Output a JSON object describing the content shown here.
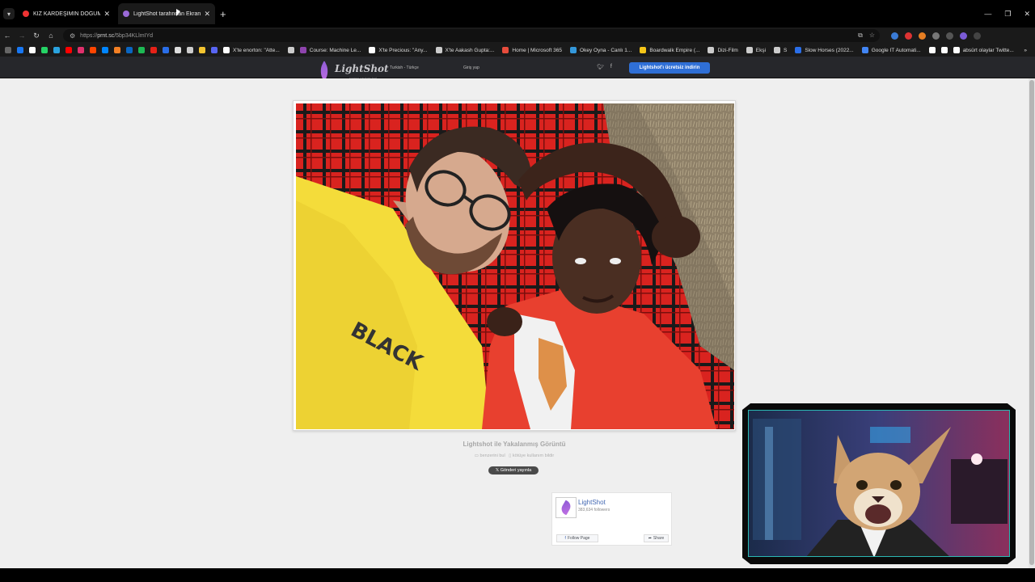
{
  "browser": {
    "tabs": [
      {
        "label": "KIZ KARDEŞİMİN DOĞUM GÜNÜ",
        "active": false,
        "favicon_color": "#e33"
      },
      {
        "label": "LightShot tarafından Ekran Görü",
        "active": true,
        "favicon_color": "#9b6ad8"
      }
    ],
    "address": {
      "scheme": "https://",
      "host": "prnt.sc",
      "path": "/5bp34KLlmIYd"
    },
    "bookmarks": [
      {
        "label": "",
        "color": "#1877f2"
      },
      {
        "label": "",
        "color": "#ffffff"
      },
      {
        "label": "",
        "color": "#25d366"
      },
      {
        "label": "",
        "color": "#2aa3df"
      },
      {
        "label": "",
        "color": "#ff0000"
      },
      {
        "label": "",
        "color": "#e1306c"
      },
      {
        "label": "",
        "color": "#ff4500"
      },
      {
        "label": "",
        "color": "#0085ff"
      },
      {
        "label": "",
        "color": "#f48024"
      },
      {
        "label": "",
        "color": "#0a66c2"
      },
      {
        "label": "",
        "color": "#1db954"
      },
      {
        "label": "",
        "color": "#e62117"
      },
      {
        "label": "",
        "color": "#2a6ee8"
      },
      {
        "label": "",
        "color": "#dddddd"
      },
      {
        "label": "",
        "color": "#cccccc"
      },
      {
        "label": "",
        "color": "#f4c430"
      },
      {
        "label": "",
        "color": "#5865f2"
      },
      {
        "label": "X'te enorton: \"Atte...",
        "color": "#ffffff"
      },
      {
        "label": "",
        "color": "#cccccc"
      },
      {
        "label": "Course: Machine Le...",
        "color": "#8e44ad"
      },
      {
        "label": "X'te Precious: \"Any...",
        "color": "#ffffff"
      },
      {
        "label": "X'te Aakash Gupta:...",
        "color": "#cccccc"
      },
      {
        "label": "Home | Microsoft 365",
        "color": "#e74c3c"
      },
      {
        "label": "Okey Oyna - Canlı 1...",
        "color": "#3498db"
      },
      {
        "label": "Boardwalk Empire (...",
        "color": "#f5c518"
      },
      {
        "label": "Dizi-Film",
        "color": "#cccccc"
      },
      {
        "label": "Ekşi",
        "color": "#cccccc"
      },
      {
        "label": "S",
        "color": "#cccccc"
      },
      {
        "label": "Slow Horses (2022...",
        "color": "#2a6ee8"
      },
      {
        "label": "Google IT Automati...",
        "color": "#4285f4"
      },
      {
        "label": "",
        "color": "#ffffff"
      },
      {
        "label": "",
        "color": "#ffffff"
      },
      {
        "label": "absürt olaylar Twitte...",
        "color": "#ffffff"
      }
    ]
  },
  "lightshot": {
    "logo_name": "LightShot",
    "logo_tagline": "screen capture tool",
    "language": "Turkish - Türkçe",
    "login": "Giriş yap",
    "download": "Lightshot'ı ücretsiz indirin",
    "caption": "Lightshot ile Yakalanmış Görüntü",
    "similar": "benzerini bul",
    "report": "kötüye kullanım bildir",
    "post_button": "Gönderi yayınla",
    "facebook": {
      "page_name": "LightShot",
      "followers": "383,634 followers",
      "follow": "Follow Page",
      "share": "Share"
    }
  },
  "photo": {
    "shirt_text": "BLACK"
  }
}
